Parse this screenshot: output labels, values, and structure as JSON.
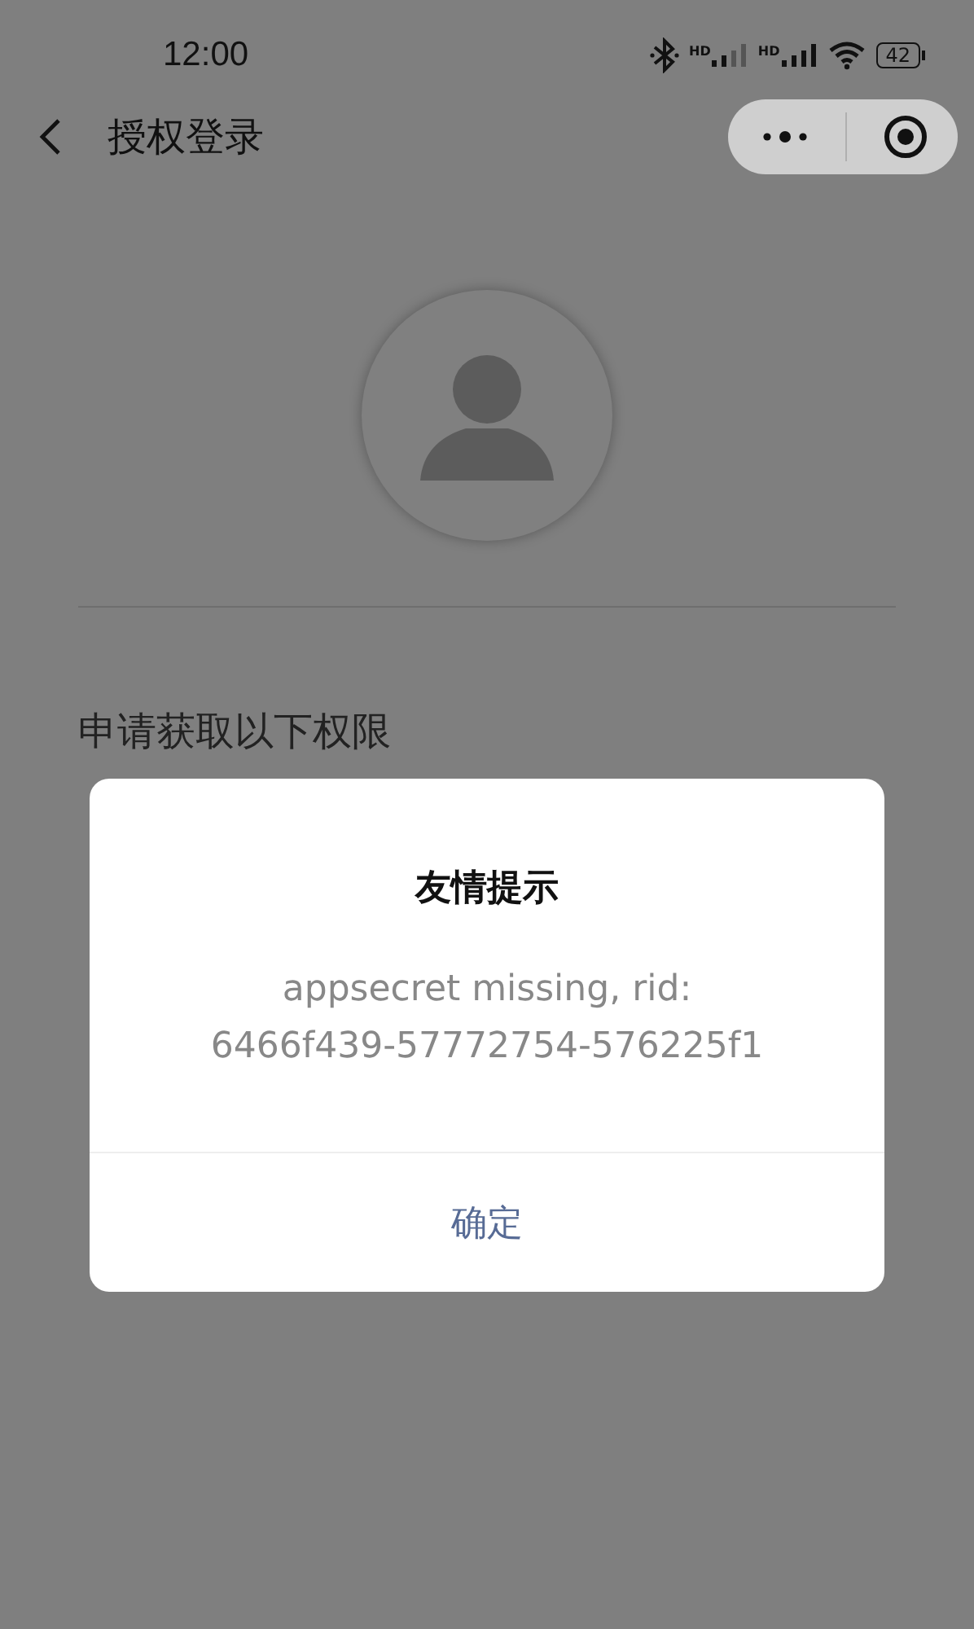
{
  "status_bar": {
    "time": "12:00",
    "battery": "42",
    "hd_labels": [
      "HD",
      "HD"
    ]
  },
  "nav": {
    "title": "授权登录"
  },
  "section": {
    "heading": "申请获取以下权限"
  },
  "dialog": {
    "title": "友情提示",
    "message_lines": [
      "appsecret missing, rid:",
      "6466f439-57772754-576225f1"
    ],
    "button": "确定"
  }
}
